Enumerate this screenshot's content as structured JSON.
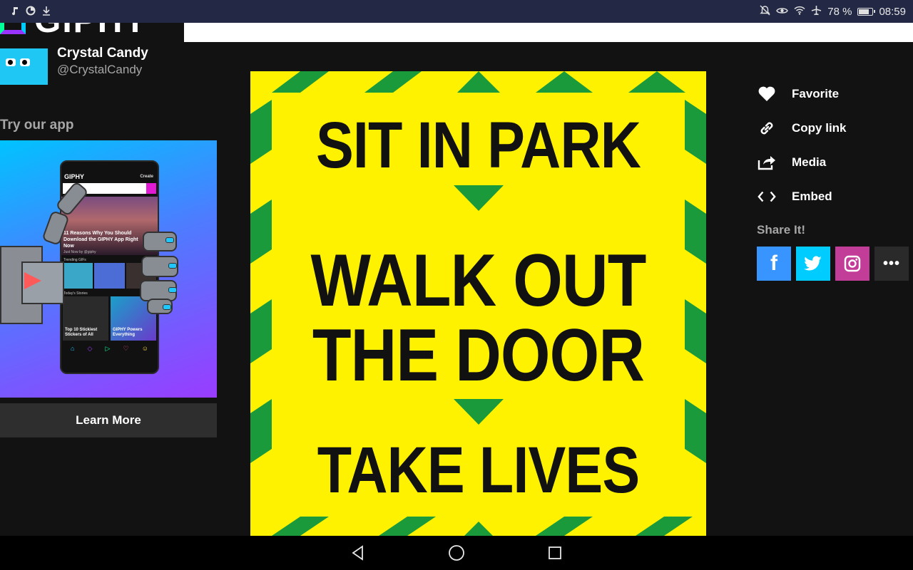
{
  "status_bar": {
    "battery_percent": "78 %",
    "battery_level": 0.78,
    "time": "08:59",
    "icons": [
      "music-note-icon",
      "data-saver-icon",
      "download-icon",
      "mute-icon",
      "eye-comfort-icon",
      "wifi-icon",
      "airplane-icon",
      "battery-icon"
    ]
  },
  "header": {
    "logo_text": "GIPHY"
  },
  "creator": {
    "name": "Crystal Candy",
    "handle": "@CrystalCandy"
  },
  "app_promo": {
    "heading": "Try our app",
    "button_label": "Learn More",
    "phone": {
      "brand": "GIPHY",
      "create": "Create",
      "hero_text": "11 Reasons Why You Should Download the GIPHY App Right Now",
      "hero_sub": "Just Now by @giphy",
      "trending_label": "Trending GIFs",
      "stories_label": "Today's Stories",
      "story_1": "Top 10 Stickiest Stickers of All",
      "story_2": "GIPHY Powers Everything"
    }
  },
  "gif": {
    "line_1": "SIT IN PARK",
    "line_2": "WALK OUT",
    "line_3": "THE DOOR",
    "line_4": "TAKE LIVES",
    "colors": {
      "background": "#fff200",
      "stripe": "#1a9a3a",
      "text": "#111111"
    }
  },
  "actions": [
    {
      "label": "Favorite",
      "icon": "heart-icon"
    },
    {
      "label": "Copy link",
      "icon": "link-icon"
    },
    {
      "label": "Media",
      "icon": "share-media-icon"
    },
    {
      "label": "Embed",
      "icon": "code-icon"
    }
  ],
  "share": {
    "label": "Share It!",
    "buttons": [
      "facebook-icon",
      "twitter-icon",
      "instagram-icon",
      "more-icon"
    ],
    "facebook_glyph": "f",
    "more_glyph": "•••"
  },
  "nav_bar": {
    "buttons": [
      "back-icon",
      "home-icon",
      "recents-icon"
    ]
  }
}
